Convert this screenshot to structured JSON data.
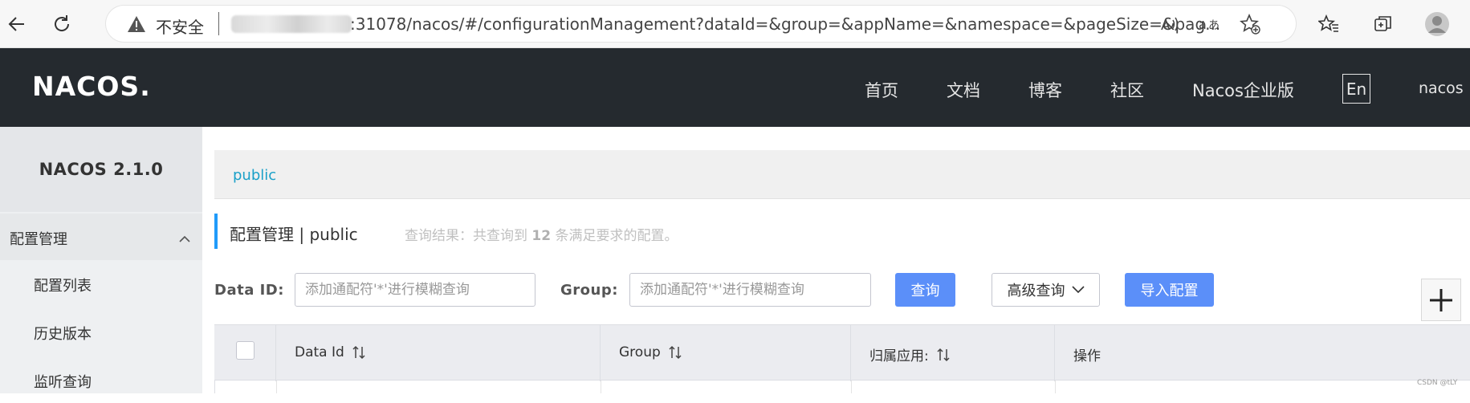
{
  "browser": {
    "security_label": "不安全",
    "url": ":31078/nacos/#/configurationManagement?dataId=&group=&appName=&namespace=&pageSize=&pag..."
  },
  "header": {
    "logo": "NACOS.",
    "nav": [
      "首页",
      "文档",
      "博客",
      "社区",
      "Nacos企业版"
    ],
    "lang_button": "En",
    "user": "nacos"
  },
  "sidebar": {
    "version": "NACOS 2.1.0",
    "group_label": "配置管理",
    "items": [
      "配置列表",
      "历史版本",
      "监听查询"
    ]
  },
  "namespace_bar": {
    "active": "public"
  },
  "title": {
    "main": "配置管理 | public",
    "result_prefix": "查询结果：共查询到 ",
    "result_count": "12",
    "result_suffix": " 条满足要求的配置。"
  },
  "search": {
    "dataid_label": "Data ID:",
    "dataid_placeholder": "添加通配符'*'进行模糊查询",
    "group_label": "Group:",
    "group_placeholder": "添加通配符'*'进行模糊查询",
    "query_button": "查询",
    "advanced_button": "高级查询",
    "import_button": "导入配置"
  },
  "table": {
    "columns": [
      "Data Id",
      "Group",
      "归属应用:",
      "操作"
    ]
  },
  "watermark": "CSDN @tLY"
}
